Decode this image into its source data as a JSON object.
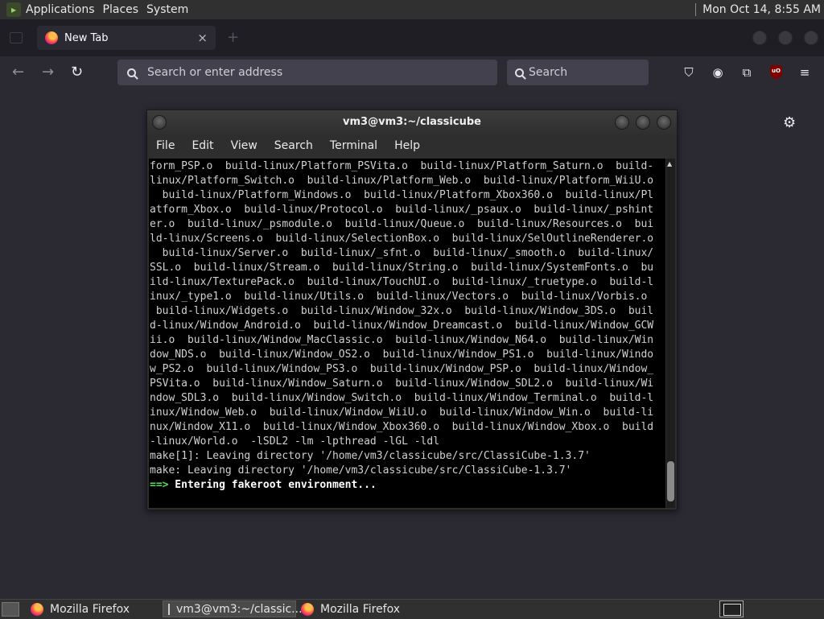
{
  "top_panel": {
    "menus": [
      "Applications",
      "Places",
      "System"
    ],
    "clock": "Mon Oct 14,  8:55 AM"
  },
  "browser": {
    "tab_title": "New Tab",
    "tab_close_glyph": "×",
    "url_placeholder": "Search or enter address",
    "search_placeholder": "Search",
    "ublock_label": "uO"
  },
  "terminal": {
    "title": "vm3@vm3:~/classicube",
    "menu": [
      "File",
      "Edit",
      "View",
      "Search",
      "Terminal",
      "Help"
    ],
    "lines": [
      "form_PSP.o  build-linux/Platform_PSVita.o  build-linux/Platform_Saturn.o  build-",
      "linux/Platform_Switch.o  build-linux/Platform_Web.o  build-linux/Platform_WiiU.o",
      "  build-linux/Platform_Windows.o  build-linux/Platform_Xbox360.o  build-linux/Pl",
      "atform_Xbox.o  build-linux/Protocol.o  build-linux/_psaux.o  build-linux/_pshint",
      "er.o  build-linux/_psmodule.o  build-linux/Queue.o  build-linux/Resources.o  bui",
      "ld-linux/Screens.o  build-linux/SelectionBox.o  build-linux/SelOutlineRenderer.o",
      "  build-linux/Server.o  build-linux/_sfnt.o  build-linux/_smooth.o  build-linux/",
      "SSL.o  build-linux/Stream.o  build-linux/String.o  build-linux/SystemFonts.o  bu",
      "ild-linux/TexturePack.o  build-linux/TouchUI.o  build-linux/_truetype.o  build-l",
      "inux/_type1.o  build-linux/Utils.o  build-linux/Vectors.o  build-linux/Vorbis.o",
      " build-linux/Widgets.o  build-linux/Window_32x.o  build-linux/Window_3DS.o  buil",
      "d-linux/Window_Android.o  build-linux/Window_Dreamcast.o  build-linux/Window_GCW",
      "ii.o  build-linux/Window_MacClassic.o  build-linux/Window_N64.o  build-linux/Win",
      "dow_NDS.o  build-linux/Window_OS2.o  build-linux/Window_PS1.o  build-linux/Windo",
      "w_PS2.o  build-linux/Window_PS3.o  build-linux/Window_PSP.o  build-linux/Window_",
      "PSVita.o  build-linux/Window_Saturn.o  build-linux/Window_SDL2.o  build-linux/Wi",
      "ndow_SDL3.o  build-linux/Window_Switch.o  build-linux/Window_Terminal.o  build-l",
      "inux/Window_Web.o  build-linux/Window_WiiU.o  build-linux/Window_Win.o  build-li",
      "nux/Window_X11.o  build-linux/Window_Xbox360.o  build-linux/Window_Xbox.o  build",
      "-linux/World.o  -lSDL2 -lm -lpthread -lGL -ldl",
      "make[1]: Leaving directory '/home/vm3/classicube/src/ClassiCube-1.3.7'",
      "make: Leaving directory '/home/vm3/classicube/src/ClassiCube-1.3.7'"
    ],
    "prompt_arrow": "==>",
    "prompt_text": " Entering fakeroot environment..."
  },
  "taskbar": {
    "items": [
      {
        "label": "Mozilla Firefox"
      },
      {
        "label": "vm3@vm3:~/classic..."
      },
      {
        "label": "Mozilla Firefox"
      }
    ]
  },
  "icons": {
    "back": "back-arrow-icon",
    "forward": "forward-arrow-icon",
    "reload": "reload-icon",
    "pocket": "pocket-icon",
    "account": "account-icon",
    "extensions": "extensions-icon",
    "menu": "hamburger-menu-icon",
    "settings": "gear-icon"
  },
  "colors": {
    "browser_bg": "#2b2a33",
    "terminal_bg": "#000000",
    "prompt_green": "#55e055"
  }
}
